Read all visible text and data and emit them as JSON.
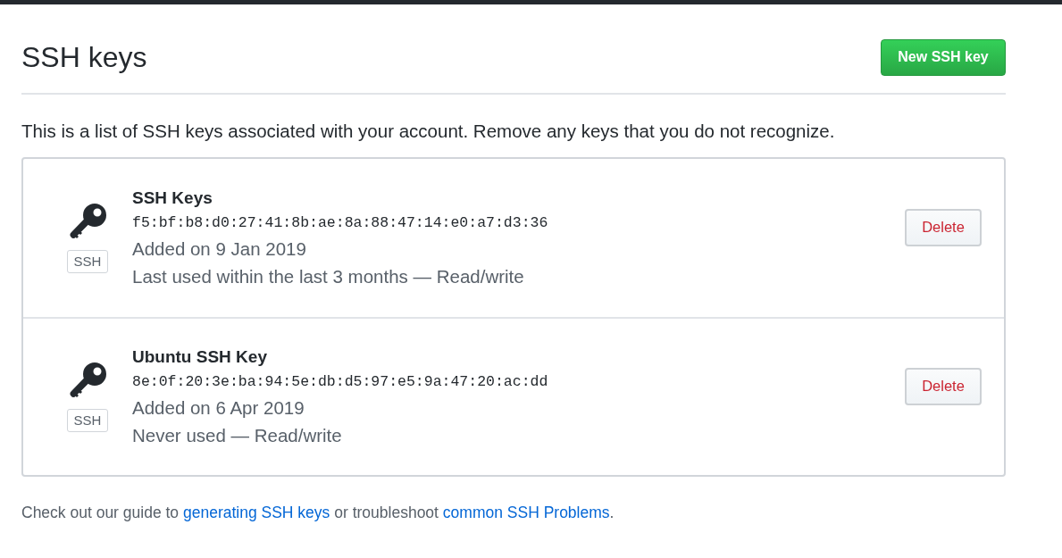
{
  "header": {
    "title": "SSH keys",
    "new_button": "New SSH key"
  },
  "description": "This is a list of SSH keys associated with your account. Remove any keys that you do not recognize.",
  "keys": [
    {
      "title": "SSH Keys",
      "badge": "SSH",
      "fingerprint": "f5:bf:b8:d0:27:41:8b:ae:8a:88:47:14:e0:a7:d3:36",
      "added": "Added on 9 Jan 2019",
      "last_used": "Last used within the last 3 months — Read/write",
      "delete_button": "Delete"
    },
    {
      "title": "Ubuntu SSH Key",
      "badge": "SSH",
      "fingerprint": "8e:0f:20:3e:ba:94:5e:db:d5:97:e5:9a:47:20:ac:dd",
      "added": "Added on 6 Apr 2019",
      "last_used": "Never used — Read/write",
      "delete_button": "Delete"
    }
  ],
  "footer": [
    {
      "kind": "text",
      "text": "Check out our guide to "
    },
    {
      "kind": "link",
      "text": "generating SSH keys"
    },
    {
      "kind": "text",
      "text": " or troubleshoot "
    },
    {
      "kind": "link",
      "text": "common SSH Problems"
    },
    {
      "kind": "text",
      "text": "."
    }
  ]
}
